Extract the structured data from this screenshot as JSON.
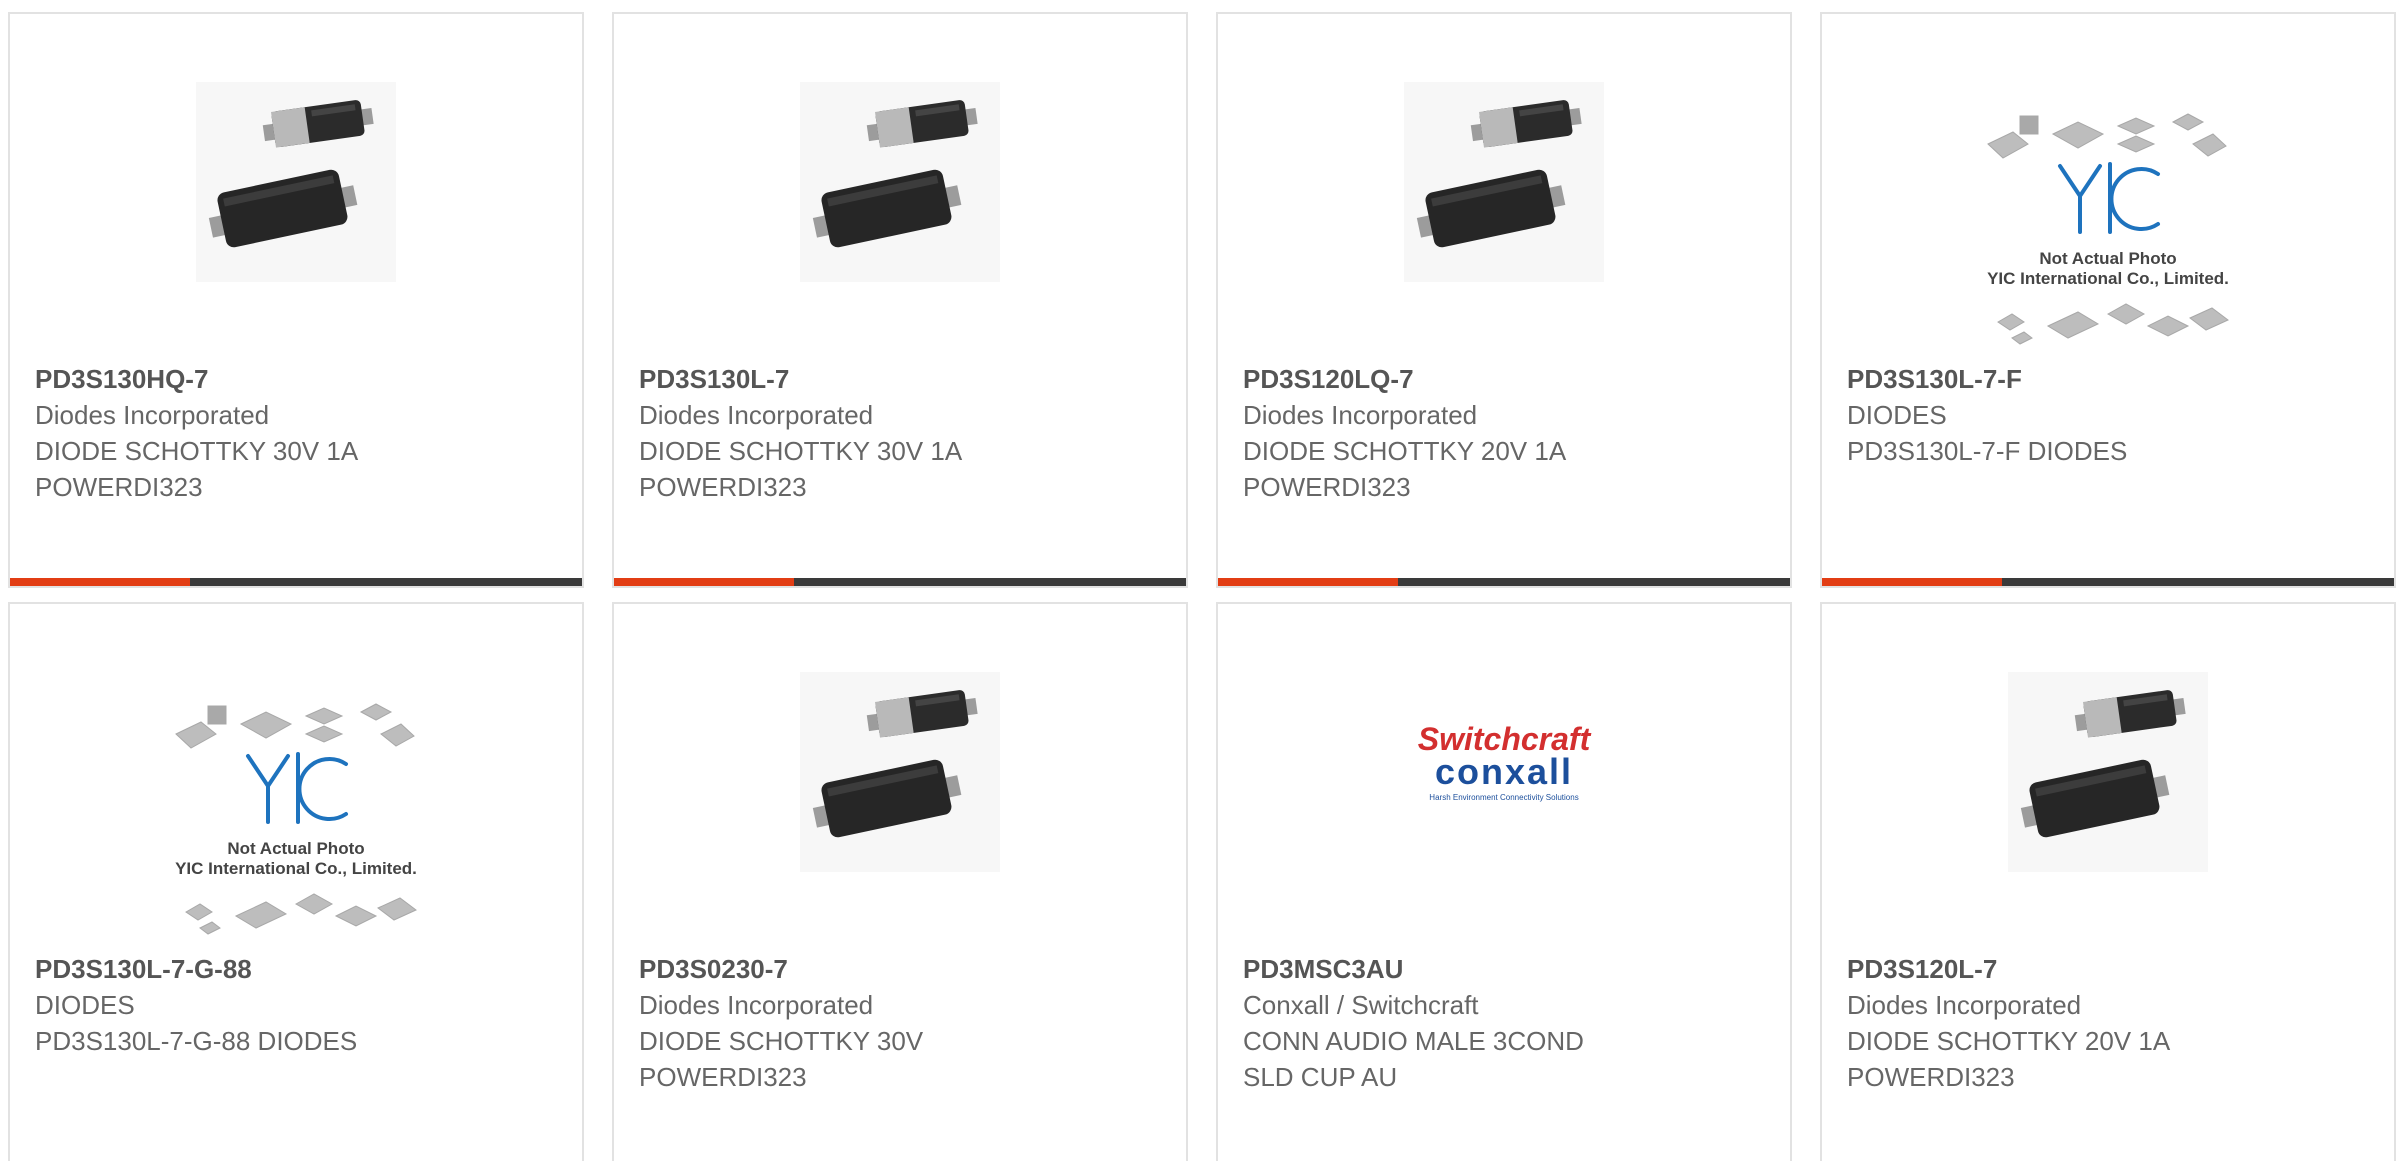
{
  "colors": {
    "card_border": "#e2e2e2",
    "part_number_text": "#555555",
    "body_text": "#666666",
    "accent_bar": "#e23d14",
    "bar_track": "#3a3a3a"
  },
  "products": [
    {
      "part_number": "PD3S130HQ-7",
      "manufacturer": "Diodes Incorporated",
      "description": "DIODE SCHOTTKY 30V 1A\nPOWERDI323",
      "image_type": "diode-package-photo"
    },
    {
      "part_number": "PD3S130L-7",
      "manufacturer": "Diodes Incorporated",
      "description": "DIODE SCHOTTKY 30V 1A\nPOWERDI323",
      "image_type": "diode-package-photo"
    },
    {
      "part_number": "PD3S120LQ-7",
      "manufacturer": "Diodes Incorporated",
      "description": "DIODE SCHOTTKY 20V 1A\nPOWERDI323",
      "image_type": "diode-package-photo"
    },
    {
      "part_number": "PD3S130L-7-F",
      "manufacturer": "DIODES",
      "description": "PD3S130L-7-F DIODES",
      "image_type": "yic-placeholder",
      "image_caption_1": "Not Actual Photo",
      "image_caption_2": "YIC International Co., Limited."
    },
    {
      "part_number": "PD3S130L-7-G-88",
      "manufacturer": "DIODES",
      "description": "PD3S130L-7-G-88 DIODES",
      "image_type": "yic-placeholder",
      "image_caption_1": "Not Actual Photo",
      "image_caption_2": "YIC International Co., Limited."
    },
    {
      "part_number": "PD3S0230-7",
      "manufacturer": "Diodes Incorporated",
      "description": "DIODE SCHOTTKY 30V\nPOWERDI323",
      "image_type": "diode-package-photo"
    },
    {
      "part_number": "PD3MSC3AU",
      "manufacturer": "Conxall / Switchcraft",
      "description": "CONN AUDIO MALE 3COND\nSLD CUP AU",
      "image_type": "switchcraft-conxall-logo",
      "logo_text_1": "Switchcraft",
      "logo_text_2": "conxall",
      "logo_tagline": "Harsh Environment Connectivity Solutions"
    },
    {
      "part_number": "PD3S120L-7",
      "manufacturer": "Diodes Incorporated",
      "description": "DIODE SCHOTTKY 20V 1A\nPOWERDI323",
      "image_type": "diode-package-photo"
    }
  ]
}
